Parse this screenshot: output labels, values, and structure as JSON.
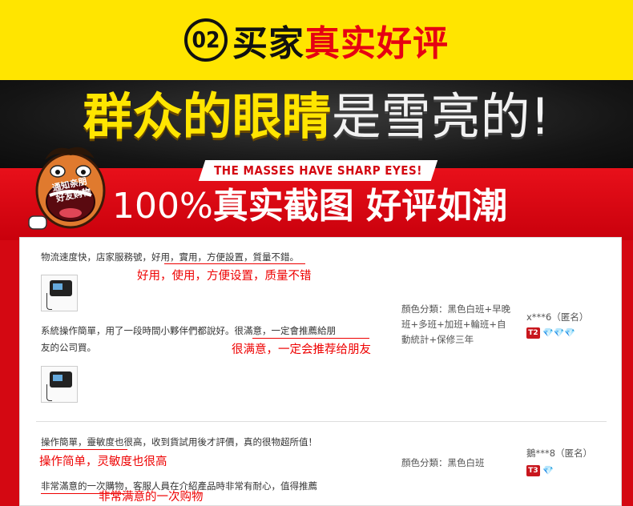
{
  "header": {
    "number": "02",
    "title_black": "买家",
    "title_red": "真实好评"
  },
  "headline": {
    "yellow": "群众的眼睛",
    "white": "是雪亮的!"
  },
  "mascot": {
    "bubble_line1": "通知亲朋",
    "bubble_line2": "好友购物"
  },
  "banner": {
    "english": "THE MASSES HAVE SHARP EYES!",
    "percent": "100%",
    "rest": "真实截图 好评如潮"
  },
  "reviews": [
    {
      "text_line1": "物流速度快，店家服務號，好用，實用，方便設置，質量不錯。",
      "annotation1": "好用，使用，方便设置，质量不错",
      "text_line2a": "系統操作簡單，用了一段時間小夥伴們都說好。很滿意，一定會推薦給朋",
      "text_line2b": "友的公司買。",
      "annotation2": "很满意，一定会推荐给朋友",
      "meta_label": "顏色分類：",
      "meta_value": "黑色白班+早晚班+多班+加班+輪班+自動統計+保修三年",
      "user": "x***6（匿名）",
      "level": "T2",
      "gems": "💎💎💎"
    },
    {
      "text_line1": "操作簡單，靈敏度也很高，收到貨試用後才評價，真的很物超所值！",
      "annotation1": "操作简单，灵敏度也很高",
      "text_line2": "非常滿意的一次購物，客服人員在介紹產品時非常有耐心，值得推薦",
      "annotation2": "非常满意的一次购物",
      "meta_label": "顏色分類：",
      "meta_value": "黑色白班",
      "user": "鵝***8（匿名）",
      "level": "T3",
      "gems": "💎"
    }
  ],
  "colors": {
    "yellow": "#ffe500",
    "red": "#d40812",
    "annotation_red": "#e00000"
  }
}
